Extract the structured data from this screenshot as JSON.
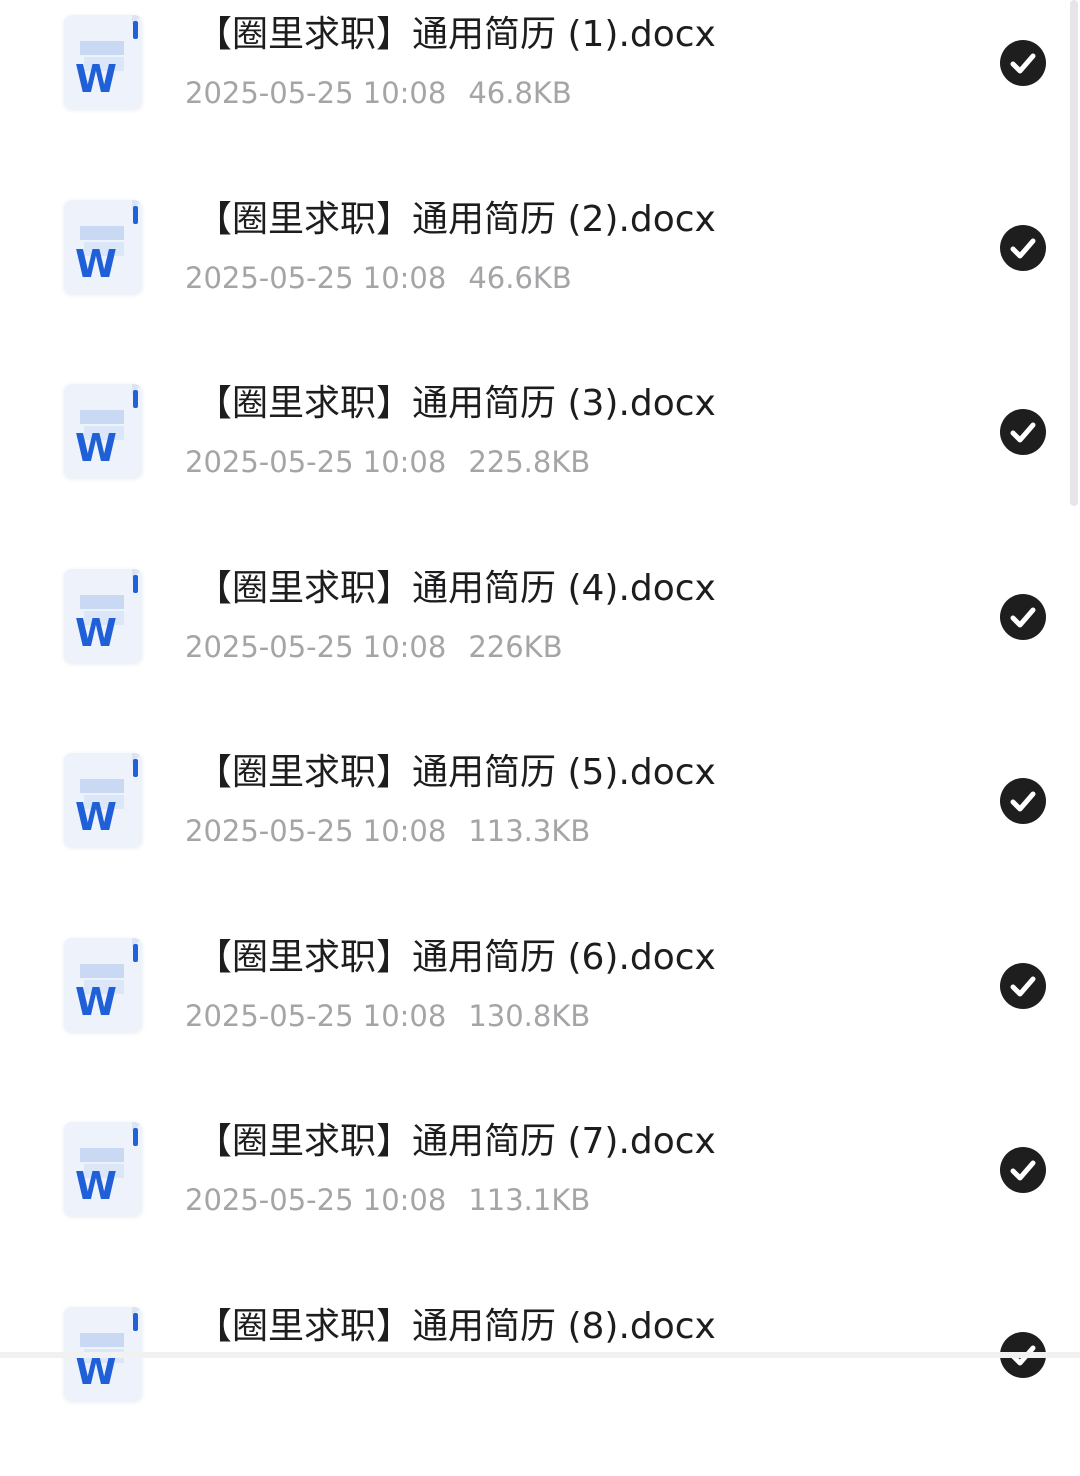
{
  "files": [
    {
      "name": "【圈里求职】通用简历 (1).docx",
      "date": "2025-05-25 10:08",
      "size": "46.8KB",
      "selected": true,
      "icon": "word-doc-icon"
    },
    {
      "name": "【圈里求职】通用简历 (2).docx",
      "date": "2025-05-25 10:08",
      "size": "46.6KB",
      "selected": true,
      "icon": "word-doc-icon"
    },
    {
      "name": "【圈里求职】通用简历 (3).docx",
      "date": "2025-05-25 10:08",
      "size": "225.8KB",
      "selected": true,
      "icon": "word-doc-icon"
    },
    {
      "name": "【圈里求职】通用简历 (4).docx",
      "date": "2025-05-25 10:08",
      "size": "226KB",
      "selected": true,
      "icon": "word-doc-icon"
    },
    {
      "name": "【圈里求职】通用简历 (5).docx",
      "date": "2025-05-25 10:08",
      "size": "113.3KB",
      "selected": true,
      "icon": "word-doc-icon"
    },
    {
      "name": "【圈里求职】通用简历 (6).docx",
      "date": "2025-05-25 10:08",
      "size": "130.8KB",
      "selected": true,
      "icon": "word-doc-icon"
    },
    {
      "name": "【圈里求职】通用简历 (7).docx",
      "date": "2025-05-25 10:08",
      "size": "113.1KB",
      "selected": true,
      "icon": "word-doc-icon"
    },
    {
      "name": "【圈里求职】通用简历 (8).docx",
      "date": "",
      "size": "",
      "selected": true,
      "icon": "word-doc-icon"
    }
  ],
  "icon_letter": "W",
  "colors": {
    "word_blue": "#1f5fd8",
    "check_fill": "#1e1e1e",
    "meta_text": "#a5a5a8",
    "title_text": "#1d1d1f"
  },
  "scroll_fraction_visible": 0.37
}
